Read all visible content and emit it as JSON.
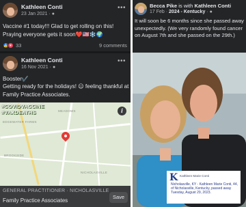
{
  "posts": [
    {
      "author": "Kathleen Conti",
      "date": "23 Jan 2021",
      "visibility_icon": "globe-icon",
      "text": "Vaccine #1 today!!! Glad to get rolling on this! Praying everyone gets it soon❤️🇺🇸❄️🌍",
      "reaction_count": "33",
      "comments": "9 comments"
    },
    {
      "author": "Kathleen Conti",
      "date": "16 Nov 2021",
      "visibility_icon": "globe-icon",
      "text_line1": "Booster✔️",
      "text_line2": "Getting ready for the holidays! 😑 feeling thankful at Family Practice Associates.",
      "stamp": "#COVIDVACCINE #VAXDEATHS",
      "location": {
        "category": "GENERAL PRACTITIONER · NICHOLASVILLE",
        "name": "Family Practice Associates",
        "save_label": "Save",
        "map_labels": [
          "MEADOWS",
          "EDGEWATER FARMS",
          "BROOKSIDE",
          "NICHOLASVILLE"
        ]
      }
    }
  ],
  "right_post": {
    "author": "Becca Pike",
    "with_text": "is with",
    "tagged": "Kathleen Conti",
    "date": "17 Feb",
    "year_tag": "2024 - Kentucky",
    "visibility_icon": "globe-icon",
    "text": "It will soon be 6 months since she passed away unexpectedly. (We very randomly found cancer on August 7th and she passed on the 29th.)",
    "obituary": {
      "name": "Kathleen Marie Conti",
      "text": "Nicholasville, KY - Kathleen Marie Conti, 44, of Nicholasville, Kentucky, passed away Tuesday, August 29, 2023."
    }
  },
  "colors": {
    "panel_bg": "#242526",
    "text": "#e4e6eb",
    "muted": "#b0b3b8",
    "like": "#1877f2",
    "love": "#f33e58",
    "stamp_text": "#ffffff",
    "obituary_text": "#2a3a8a"
  }
}
